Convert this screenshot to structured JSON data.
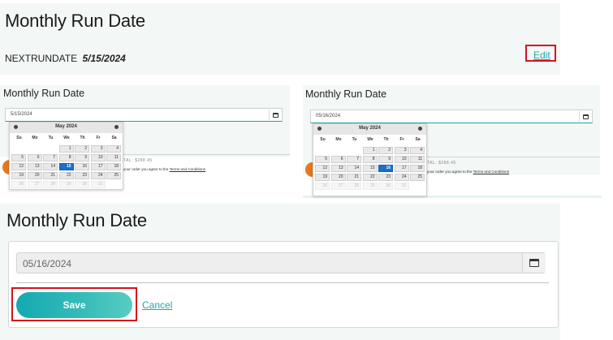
{
  "top": {
    "title": "Monthly Run Date",
    "next_label": "NEXTRUNDATE",
    "next_date": "5/15/2024",
    "edit": "Edit"
  },
  "left_cal": {
    "title": "Monthly Run Date",
    "input_value": "5/15/2024",
    "month": "May 2024",
    "dow": [
      "Su",
      "Mo",
      "Tu",
      "We",
      "Th",
      "Fr",
      "Sa"
    ],
    "weeks": [
      [
        "",
        "",
        "",
        "1",
        "2",
        "3",
        "4"
      ],
      [
        "5",
        "6",
        "7",
        "8",
        "9",
        "10",
        "11"
      ],
      [
        "12",
        "13",
        "14",
        "15",
        "16",
        "17",
        "18"
      ],
      [
        "19",
        "20",
        "21",
        "22",
        "23",
        "24",
        "25"
      ],
      [
        "26",
        "27",
        "28",
        "29",
        "30",
        "31",
        ""
      ]
    ],
    "selected": "15",
    "total_fragment": "TAL: $288.45",
    "terms_text": "your order you agree to the",
    "terms_link": "Terms and Conditions"
  },
  "right_cal": {
    "title": "Monthly Run Date",
    "input_value": "05/16/2024",
    "month": "May 2024",
    "dow": [
      "Su",
      "Mo",
      "Tu",
      "We",
      "Th",
      "Fr",
      "Sa"
    ],
    "weeks": [
      [
        "",
        "",
        "",
        "1",
        "2",
        "3",
        "4"
      ],
      [
        "5",
        "6",
        "7",
        "8",
        "9",
        "10",
        "11"
      ],
      [
        "12",
        "13",
        "14",
        "15",
        "16",
        "17",
        "18"
      ],
      [
        "19",
        "20",
        "21",
        "22",
        "23",
        "24",
        "25"
      ],
      [
        "26",
        "27",
        "28",
        "29",
        "30",
        "31",
        ""
      ]
    ],
    "selected": "16",
    "total_fragment": "TAL: $288.45",
    "terms_text": "your order you agree to the",
    "terms_link": "Terms and Conditions"
  },
  "bottom": {
    "title": "Monthly Run Date",
    "input_value": "05/16/2024",
    "save": "Save",
    "cancel": "Cancel"
  },
  "colors": {
    "accent": "#21a7a7",
    "highlight_box": "#d4121e",
    "selected_day": "#1b6fcb",
    "orange": "#e8771f"
  },
  "icons": {
    "calendar": "calendar-icon",
    "prev": "prev-month-icon",
    "next": "next-month-icon"
  }
}
